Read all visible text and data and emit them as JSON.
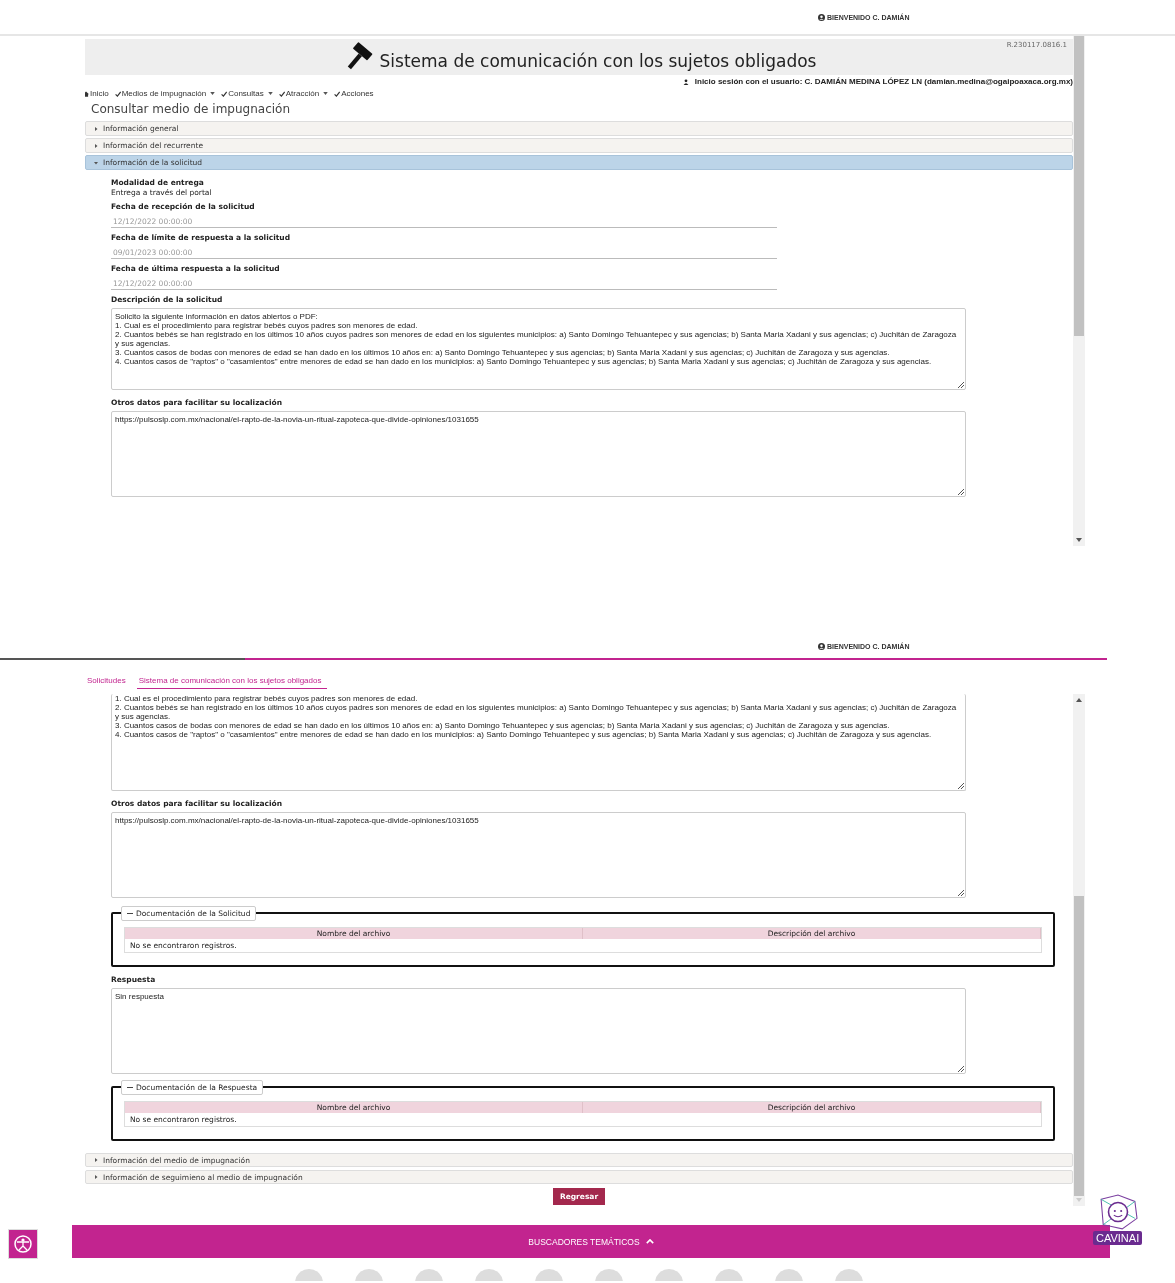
{
  "top": {
    "welcome": "BIENVENIDO C. DAMIÁN",
    "version": "R.230117.0816.1",
    "title": "Sistema de comunicación con los sujetos obligados",
    "login": "Inicio sesión con el usuario: C. DAMIÁN MEDINA LÓPEZ LN (damian.medina@ogaipoaxaca.org.mx)",
    "nav": [
      {
        "label": "Inicio",
        "kind": "home",
        "dropdown": false
      },
      {
        "label": "Medios de impugnación",
        "kind": "check",
        "dropdown": true
      },
      {
        "label": "Consultas",
        "kind": "check",
        "dropdown": true
      },
      {
        "label": "Atracción",
        "kind": "check",
        "dropdown": true
      },
      {
        "label": "Acciones",
        "kind": "check",
        "dropdown": false
      }
    ],
    "page_title": "Consultar medio de impugnación",
    "sections": [
      {
        "label": "Información general",
        "expanded": false
      },
      {
        "label": "Información del recurrente",
        "expanded": false
      },
      {
        "label": "Información de la solicitud",
        "expanded": true
      }
    ],
    "modalidad": {
      "label": "Modalidad de entrega",
      "value": "Entrega a través del portal"
    },
    "dates": [
      {
        "label": "Fecha de recepción de la solicitud",
        "value": "12/12/2022 00:00:00"
      },
      {
        "label": "Fecha de límite de respuesta a la solicitud",
        "value": "09/01/2023 00:00:00"
      },
      {
        "label": "Fecha de última respuesta a la solicitud",
        "value": "12/12/2022 00:00:00"
      }
    ],
    "description": {
      "label": "Descripción de la solicitud",
      "lines": [
        "Solicito la siguiente información en datos abiertos o PDF:",
        "1. Cual es el procedimiento para registrar bebés cuyos padres son menores de edad.",
        "2. Cuantos bebés se han registrado en los últimos 10 años cuyos padres son menores de edad en los siguientes municipios: a) Santo Domingo Tehuantepec y sus agencias; b) Santa Maria Xadani y sus agencias; c) Juchitán de Zaragoza y sus agencias.",
        "3. Cuantos casos de bodas con menores de edad se han dado en los últimos 10 años en:  a) Santo Domingo Tehuantepec y sus agencias; b) Santa Maria Xadani y sus agencias; c) Juchitán de Zaragoza y sus agencias.",
        "4. Cuantos casos de \"raptos\" o \"casamientos\" entre menores de edad se han dado en los municipios: a) Santo Domingo Tehuantepec y sus agencias; b) Santa Maria Xadani y sus agencias; c) Juchitán de Zaragoza y sus agencias."
      ]
    },
    "otros": {
      "label": "Otros datos para facilitar su localización",
      "value": "https://pulsoslp.com.mx/nacional/el-rapto-de-la-novia-un-ritual-zapoteca-que-divide-opiniones/1031655"
    }
  },
  "bottom": {
    "welcome": "BIENVENIDO C. DAMIÁN",
    "tabs": [
      {
        "label": "Solicitudes",
        "selected": false
      },
      {
        "label": "Sistema de comunicación con los sujetos obligados",
        "selected": true
      }
    ],
    "description_lines": [
      "1. Cual es el procedimiento para registrar bebés cuyos padres son menores de edad.",
      "2. Cuantos bebés se han registrado en los últimos 10 años cuyos padres son menores de edad en los siguientes municipios: a) Santo Domingo Tehuantepec y sus agencias; b) Santa Maria Xadani y sus agencias; c) Juchitán de Zaragoza y sus agencias.",
      "3. Cuantos casos de bodas con menores de edad se han dado en los últimos 10 años en:  a) Santo Domingo Tehuantepec y sus agencias; b) Santa Maria Xadani y sus agencias; c) Juchitán de Zaragoza y sus agencias.",
      "4. Cuantos casos de \"raptos\" o \"casamientos\" entre menores de edad se han dado en los municipios: a) Santo Domingo Tehuantepec y sus agencias; b) Santa Maria Xadani y sus agencias; c) Juchitán de Zaragoza y sus agencias."
    ],
    "otros": {
      "label": "Otros datos para facilitar su localización",
      "value": "https://pulsoslp.com.mx/nacional/el-rapto-de-la-novia-un-ritual-zapoteca-que-divide-opiniones/1031655"
    },
    "doc_solicitud": {
      "legend": "Documentación de la Solicitud",
      "columns": [
        "Nombre del archivo",
        "Descripción del archivo"
      ],
      "empty": "No se encontraron registros."
    },
    "respuesta": {
      "label": "Respuesta",
      "value": "Sin respuesta"
    },
    "doc_respuesta": {
      "legend": "Documentación de la Respuesta",
      "columns": [
        "Nombre del archivo",
        "Descripción del archivo"
      ],
      "empty": "No se encontraron registros."
    },
    "sections": [
      {
        "label": "Información del medio de impugnación",
        "expanded": false
      },
      {
        "label": "Información de seguimieno al medio de impugnación",
        "expanded": false
      }
    ],
    "button": "Regresar",
    "banner": "BUSCADORES TEMÁTICOS",
    "logo": "CAVINAI"
  }
}
